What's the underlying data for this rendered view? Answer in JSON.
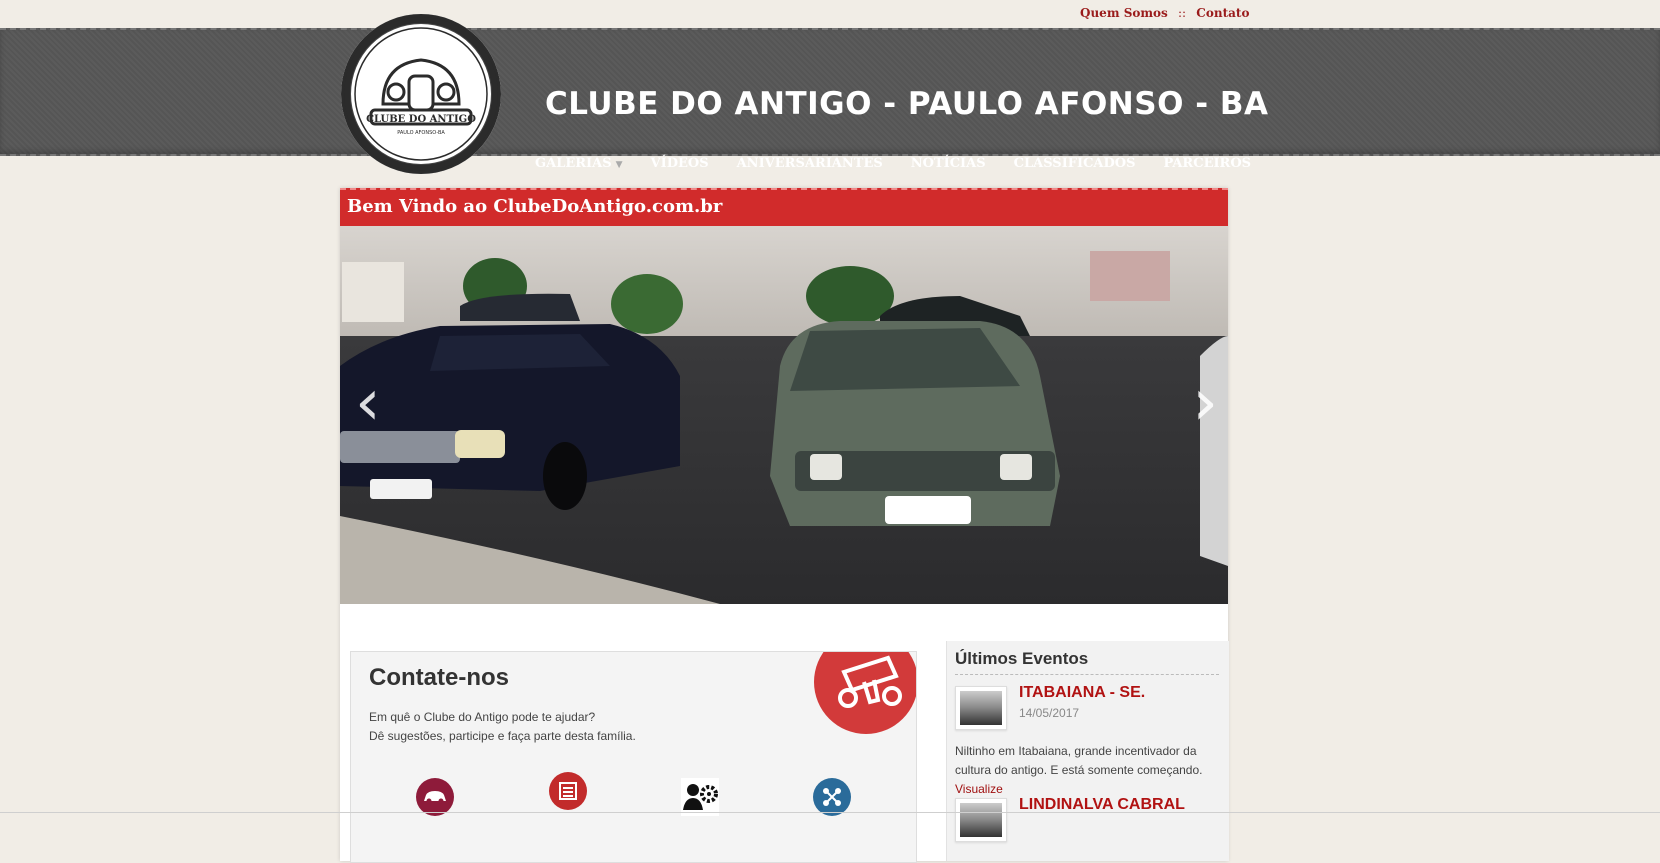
{
  "top_links": {
    "about": "Quem Somos",
    "separator": "::",
    "contact": "Contato"
  },
  "site": {
    "title": "CLUBE DO ANTIGO - PAULO AFONSO - BA",
    "logo_text": "CLUBE DO ANTIGO",
    "logo_subtext": "PAULO AFONSO-BA"
  },
  "nav": {
    "items": [
      {
        "label": "GALERIAS",
        "has_dropdown": true
      },
      {
        "label": "VÍDEOS"
      },
      {
        "label": "ANIVERSARIANTES"
      },
      {
        "label": "NOTÍCIAS"
      },
      {
        "label": "CLASSIFICADOS"
      },
      {
        "label": "PARCEIROS"
      }
    ]
  },
  "welcome": {
    "title": "Bem Vindo ao ClubeDoAntigo.com.br"
  },
  "slider": {
    "prev": "‹",
    "next": "›"
  },
  "contact": {
    "title": "Contate-nos",
    "line1": "Em quê o Clube do Antigo pode te ajudar?",
    "line2": "Dê sugestões, participe e faça parte desta família.",
    "icons": [
      "car-icon",
      "newspaper-icon",
      "gears-people-icon",
      "people-network-icon"
    ]
  },
  "events": {
    "title": "Últimos Eventos",
    "items": [
      {
        "title": "ITABAIANA - SE.",
        "date": "14/05/2017",
        "desc": "Niltinho em Itabaiana, grande incentivador da cultura do antigo. E está somente começando.",
        "link": "Visualize"
      },
      {
        "title": "LINDINALVA CABRAL"
      }
    ]
  },
  "colors": {
    "brand_red": "#d12b2b",
    "header_gray": "#555555",
    "link_red": "#b11212"
  }
}
